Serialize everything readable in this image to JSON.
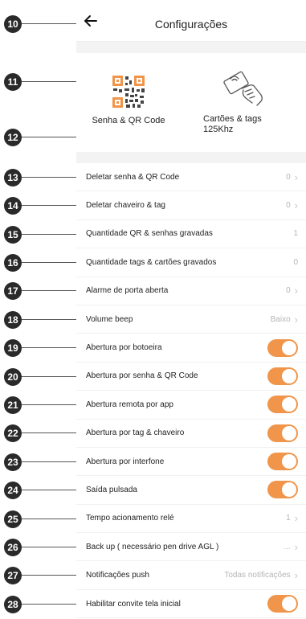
{
  "header": {
    "title": "Configurações"
  },
  "tiles": {
    "qr_label": "Senha & QR Code",
    "card_label_line1": "Cartões & tags",
    "card_label_line2": "125Khz"
  },
  "callouts": [
    "10",
    "11",
    "12",
    "13",
    "14",
    "15",
    "16",
    "17",
    "18",
    "19",
    "20",
    "21",
    "22",
    "23",
    "24",
    "25",
    "26",
    "27",
    "28"
  ],
  "rows": [
    {
      "label": "Deletar senha & QR Code",
      "value": "0",
      "chevron": true
    },
    {
      "label": "Deletar chaveiro & tag",
      "value": "0",
      "chevron": true
    },
    {
      "label": "Quantidade QR & senhas gravadas",
      "value": "1",
      "chevron": false
    },
    {
      "label": "Quantidade tags & cartões gravados",
      "value": "0",
      "chevron": false
    },
    {
      "label": "Alarme de porta aberta",
      "value": "0",
      "chevron": true
    },
    {
      "label": "Volume beep",
      "value": "Baixo",
      "chevron": true
    },
    {
      "label": "Abertura por botoeira",
      "toggle": true
    },
    {
      "label": "Abertura por senha & QR Code",
      "toggle": true
    },
    {
      "label": "Abertura remota por app",
      "toggle": true
    },
    {
      "label": "Abertura por tag & chaveiro",
      "toggle": true
    },
    {
      "label": "Abertura por interfone",
      "toggle": true
    },
    {
      "label": "Saída pulsada",
      "toggle": true
    },
    {
      "label": "Tempo acionamento relé",
      "value": "1",
      "chevron": true
    },
    {
      "label": "Back up ( necessário pen drive AGL )",
      "value": "...",
      "chevron": true
    },
    {
      "label": "Notificações push",
      "value": "Todas notificações",
      "chevron": true
    },
    {
      "label": "Habilitar convite tela inicial",
      "toggle": true
    }
  ],
  "colors": {
    "accent": "#f0954a",
    "callout": "#2a2a2a"
  }
}
